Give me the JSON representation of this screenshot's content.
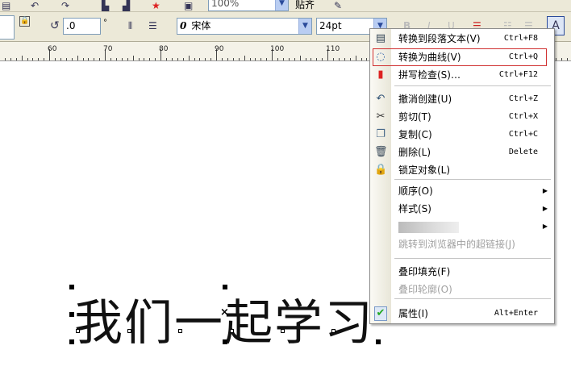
{
  "toolbar_top": {
    "zoom": "100%",
    "snap": "贴齐"
  },
  "property_bar": {
    "rotation": ".0",
    "degree": "°",
    "font": "宋体",
    "font_icon": "0",
    "size": "24pt"
  },
  "ruler": {
    "labels": [
      "60",
      "70",
      "80",
      "90",
      "100",
      "110"
    ]
  },
  "canvas": {
    "text": "我们一起学习"
  },
  "menu": {
    "items": [
      {
        "label": "转换到段落文本(V)",
        "shortcut": "Ctrl+F8",
        "icon": "paragraph-text-icon"
      },
      {
        "label": "转换为曲线(V)",
        "shortcut": "Ctrl+Q",
        "icon": "curve-icon"
      },
      {
        "label": "拼写检查(S)…",
        "shortcut": "Ctrl+F12",
        "icon": "spell-check-icon"
      },
      {
        "label": "撤消创建(U)",
        "shortcut": "Ctrl+Z",
        "icon": "undo-icon"
      },
      {
        "label": "剪切(T)",
        "shortcut": "Ctrl+X",
        "icon": "scissors-icon"
      },
      {
        "label": "复制(C)",
        "shortcut": "Ctrl+C",
        "icon": "copy-icon"
      },
      {
        "label": "删除(L)",
        "shortcut": "Delete",
        "icon": "trash-icon"
      },
      {
        "label": "锁定对象(L)",
        "shortcut": "",
        "icon": "lock-icon"
      },
      {
        "label": "顺序(O)",
        "submenu": true
      },
      {
        "label": "样式(S)",
        "submenu": true
      },
      {
        "label": "",
        "submenu": true
      },
      {
        "label": "跳转到浏览器中的超链接(J)",
        "disabled": true
      },
      {
        "label": "叠印填充(F)"
      },
      {
        "label": "叠印轮廓(O)",
        "disabled": true
      },
      {
        "label": "属性(I)",
        "shortcut": "Alt+Enter",
        "icon": "check-icon"
      }
    ]
  }
}
